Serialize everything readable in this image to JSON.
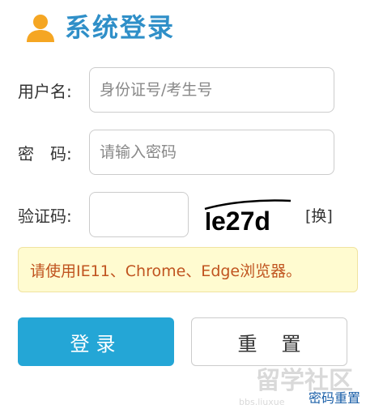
{
  "header": {
    "title": "系统登录"
  },
  "form": {
    "username_label": "用户名:",
    "username_placeholder": "身份证号/考生号",
    "password_label": "密　码:",
    "password_placeholder": "请输入密码",
    "captcha_label": "验证码:",
    "captcha_value": "",
    "captcha_image_text": "e27d",
    "captcha_refresh": "[换]"
  },
  "notice": {
    "text": "请使用IE11、Chrome、Edge浏览器。"
  },
  "buttons": {
    "login": "登录",
    "reset": "重置"
  },
  "links": {
    "forgot_password": "密码重置"
  },
  "watermark": {
    "text": "留学社区",
    "sub": "bbs.liuxue"
  },
  "colors": {
    "accent": "#24a6d6",
    "title": "#2f8fc8",
    "icon": "#f5a623",
    "notice_bg": "#fffbd0",
    "notice_text": "#c0541f"
  }
}
